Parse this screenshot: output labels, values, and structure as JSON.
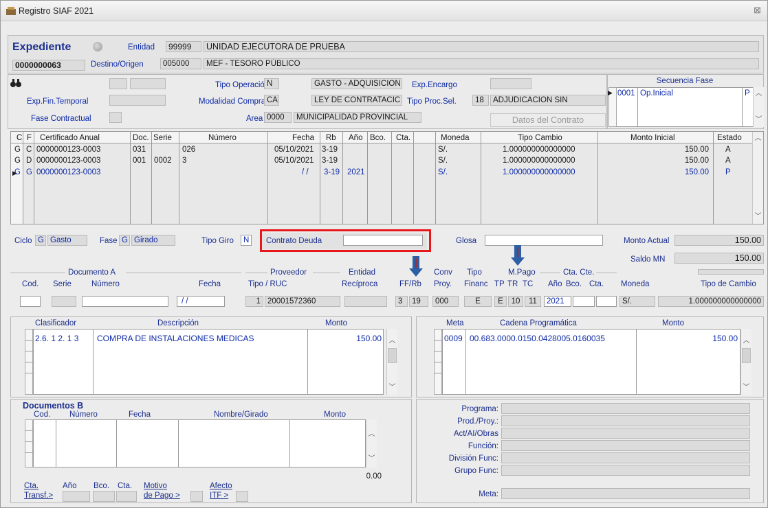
{
  "window": {
    "title": "Registro SIAF 2021",
    "close_glyph": "⊠"
  },
  "header": {
    "expediente_label": "Expediente",
    "expediente_number": "0000000063",
    "entidad_label": "Entidad",
    "entidad_code": "99999",
    "entidad_name": "UNIDAD EJECUTORA DE PRUEBA",
    "destino_label": "Destino/Origen",
    "destino_code": "005000",
    "destino_name": "MEF - TESORO PÚBLICO"
  },
  "operation": {
    "tipo_operacion_label": "Tipo Operación",
    "tipo_operacion_code": "N",
    "tipo_operacion_value": "GASTO - ADQUISICION",
    "exp_encargo_label": "Exp.Encargo",
    "exp_fin_temporal_label": "Exp.Fin.Temporal",
    "modalidad_label": "Modalidad Compra",
    "modalidad_code": "CA",
    "modalidad_value": "LEY DE CONTRATACIC",
    "tipo_proc_label": "Tipo Proc.Sel.",
    "tipo_proc_code": "18",
    "tipo_proc_value": "ADJUDICACION SIN",
    "fase_contractual_label": "Fase Contractual",
    "area_label": "Area",
    "area_code": "0000",
    "area_value": "MUNICIPALIDAD PROVINCIAL",
    "datos_contrato_label": "Datos del Contrato"
  },
  "secuencia": {
    "title": "Secuencia Fase",
    "rows": [
      {
        "code": "0001",
        "desc": "Op.Inicial",
        "estado": "P"
      }
    ]
  },
  "main_table": {
    "headers": [
      "C",
      "F",
      "Certificado Anual",
      "Doc.",
      "Serie",
      "Número",
      "Fecha",
      "Rb",
      "Año",
      "Bco.",
      "Cta.",
      "Moneda",
      "Tipo Cambio",
      "Monto Inicial",
      "Estado"
    ],
    "rows": [
      {
        "c": "G",
        "f": "C",
        "cert": "0000000123-0003",
        "doc": "031",
        "serie": "",
        "numero": "026",
        "fecha": "05/10/2021",
        "rb": "3-19",
        "anio": "",
        "bco": "",
        "cta": "",
        "moneda": "S/.",
        "tipo_cambio": "1.000000000000000",
        "monto": "150.00",
        "estado": "A"
      },
      {
        "c": "G",
        "f": "D",
        "cert": "0000000123-0003",
        "doc": "001",
        "serie": "0002",
        "numero": "3",
        "fecha": "05/10/2021",
        "rb": "3-19",
        "anio": "",
        "bco": "",
        "cta": "",
        "moneda": "S/.",
        "tipo_cambio": "1.000000000000000",
        "monto": "150.00",
        "estado": "A"
      },
      {
        "c": "G",
        "f": "G",
        "cert": "0000000123-0003",
        "doc": "",
        "serie": "",
        "numero": "",
        "fecha": "/ /",
        "rb": "3-19",
        "anio": "2021",
        "bco": "",
        "cta": "",
        "moneda": "S/.",
        "tipo_cambio": "1.000000000000000",
        "monto": "150.00",
        "estado": "P"
      }
    ]
  },
  "cycle": {
    "ciclo_label": "Ciclo",
    "ciclo_code": "G",
    "ciclo_value": "Gasto",
    "fase_label": "Fase",
    "fase_code": "G",
    "fase_value": "Girado",
    "tipo_giro_label": "Tipo Giro",
    "tipo_giro_code": "N",
    "contrato_deuda_label": "Contrato Deuda",
    "glosa_label": "Glosa",
    "monto_actual_label": "Monto Actual",
    "monto_actual_value": "150.00",
    "saldo_label": "Saldo MN",
    "saldo_value": "150.00"
  },
  "docs_a": {
    "title": "Documento A",
    "cod_label": "Cod.",
    "serie_label": "Serie",
    "numero_label": "Número",
    "fecha_label": "Fecha",
    "fecha_value": "/ /",
    "proveedor_title": "Proveedor",
    "tipo_ruc_label": "Tipo / RUC",
    "tipo_value": "1",
    "ruc_value": "20001572360",
    "entidad_title": "Entidad",
    "reciproca_label": "Recíproca",
    "ffrb_label": "FF/Rb",
    "ff_value": "3",
    "rb_value": "19",
    "conv_label": "Conv",
    "proy_label": "Proy.",
    "proy_value": "000",
    "tipo_label": "Tipo",
    "financ_label": "Financ",
    "financ_value": "E",
    "mpago_title": "M.Pago",
    "tp_label": "TP",
    "tr_label": "TR",
    "tc_label": "TC",
    "tp_value": "E",
    "tr_value": "10",
    "tc_value": "11",
    "ctacte_title": "Cta. Cte.",
    "anio_label": "Año",
    "bco_label": "Bco.",
    "cta_label": "Cta.",
    "anio_value": "2021",
    "moneda_label": "Moneda",
    "moneda_value": "S/.",
    "tipo_cambio_label": "Tipo de Cambio",
    "tipo_cambio_value": "1.000000000000000"
  },
  "clasificador": {
    "headers": [
      "Clasificador",
      "Descripción",
      "Monto"
    ],
    "rows": [
      {
        "code": "2.6. 1 2. 1 3",
        "desc": "COMPRA DE INSTALACIONES MEDICAS",
        "monto": "150.00"
      }
    ]
  },
  "meta": {
    "headers": [
      "Meta",
      "Cadena Programática",
      "Monto"
    ],
    "rows": [
      {
        "meta": "0009",
        "cadena": "00.683.0000.0150.0428005.0160035",
        "monto": "150.00"
      }
    ]
  },
  "docs_b": {
    "title": "Documentos B",
    "headers": [
      "Cod.",
      "Número",
      "Fecha",
      "Nombre/Girado",
      "Monto"
    ],
    "total": "0.00",
    "cta_label": "Cta.",
    "transf_label": "Transf.>",
    "anio_label": "Año",
    "bco_label": "Bco.",
    "cta2_label": "Cta.",
    "motivo_label": "Motivo",
    "depago_label": "de Pago >",
    "afecto_label": "Afecto",
    "itf_label": "ITF >"
  },
  "program_info": {
    "labels": [
      "Programa:",
      "Prod./Proy.:",
      "Act/AI/Obras",
      "Función:",
      "División Func:",
      "Grupo Func:",
      "Meta:"
    ]
  },
  "colors": {
    "highlight": "#e8171c",
    "annot_arrow": "#2d5fa6",
    "annot_stem": "#b3261e",
    "link_blue": "#0d2aa8"
  }
}
